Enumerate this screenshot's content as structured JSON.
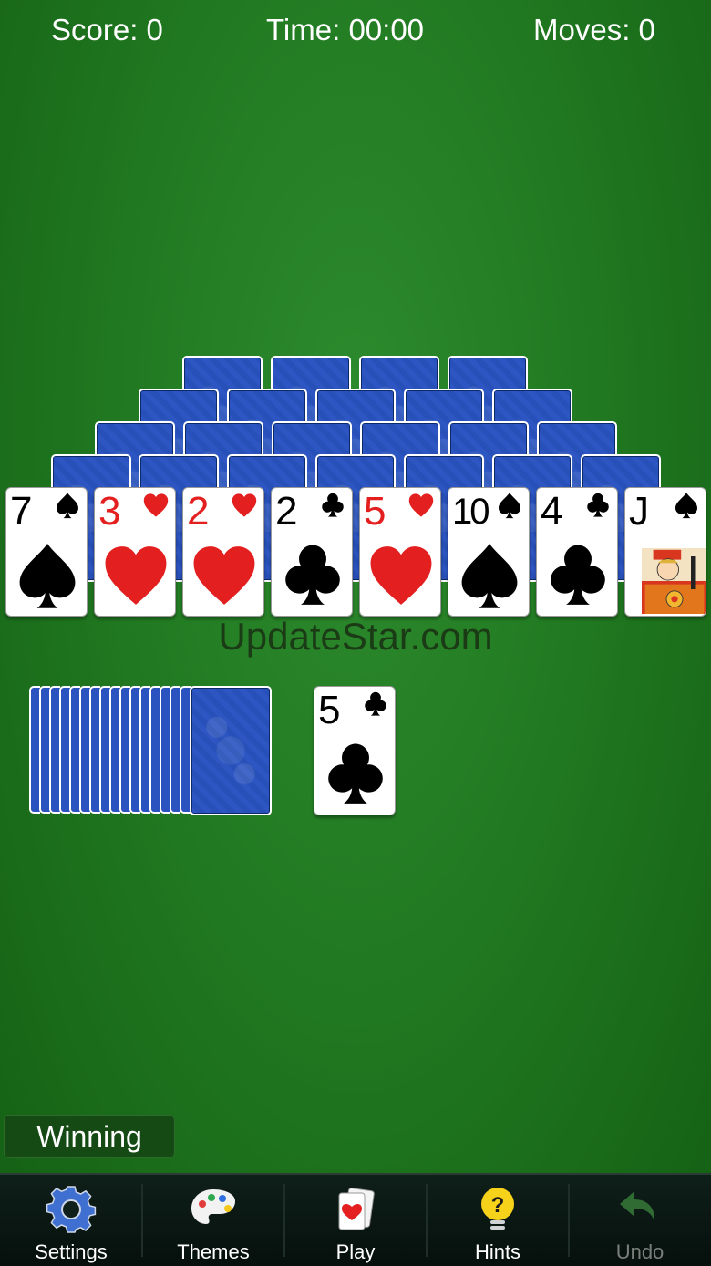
{
  "hud": {
    "score": "Score: 0",
    "time": "Time: 00:00",
    "moves": "Moves: 0"
  },
  "tableau_face_up": [
    {
      "rank": "7",
      "suit": "spade"
    },
    {
      "rank": "3",
      "suit": "heart"
    },
    {
      "rank": "2",
      "suit": "heart"
    },
    {
      "rank": "2",
      "suit": "club"
    },
    {
      "rank": "5",
      "suit": "heart"
    },
    {
      "rank": "10",
      "suit": "spade"
    },
    {
      "rank": "4",
      "suit": "club"
    },
    {
      "rank": "J",
      "suit": "spade"
    }
  ],
  "waste_card": {
    "rank": "5",
    "suit": "club"
  },
  "watermark": "UpdateStar.com",
  "status_badge": "Winning",
  "toolbar": {
    "settings": "Settings",
    "themes": "Themes",
    "play": "Play",
    "hints": "Hints",
    "undo": "Undo"
  },
  "colors": {
    "felt": "#217a21",
    "card_back": "#2d56c2",
    "red_suit": "#e41f1f"
  }
}
